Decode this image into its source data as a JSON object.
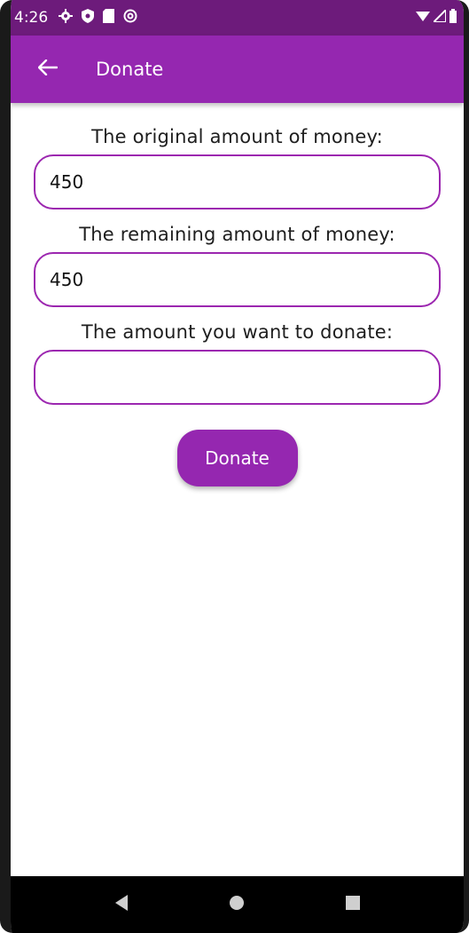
{
  "status_bar": {
    "time": "4:26",
    "left_icons": [
      "gear-icon",
      "shield-icon",
      "sd-card-icon",
      "at-sign-icon"
    ],
    "right_icons": [
      "wifi-icon",
      "signal-icon",
      "battery-icon"
    ]
  },
  "app_bar": {
    "back_icon": "arrow-left-icon",
    "title": "Donate"
  },
  "form": {
    "original_label": "The original amount of money:",
    "original_value": "450",
    "remaining_label": "The remaining amount of money:",
    "remaining_value": "450",
    "donate_label": "The amount you want to donate:",
    "donate_value": "",
    "button_label": "Donate"
  },
  "nav_bar": {
    "items": [
      "back-triangle-icon",
      "home-circle-icon",
      "recents-square-icon"
    ]
  },
  "colors": {
    "status_bar": "#6d1b7b",
    "app_bar": "#9527b0",
    "field_border": "#9c27b0",
    "button": "#9527b0",
    "nav_bar": "#000000"
  }
}
